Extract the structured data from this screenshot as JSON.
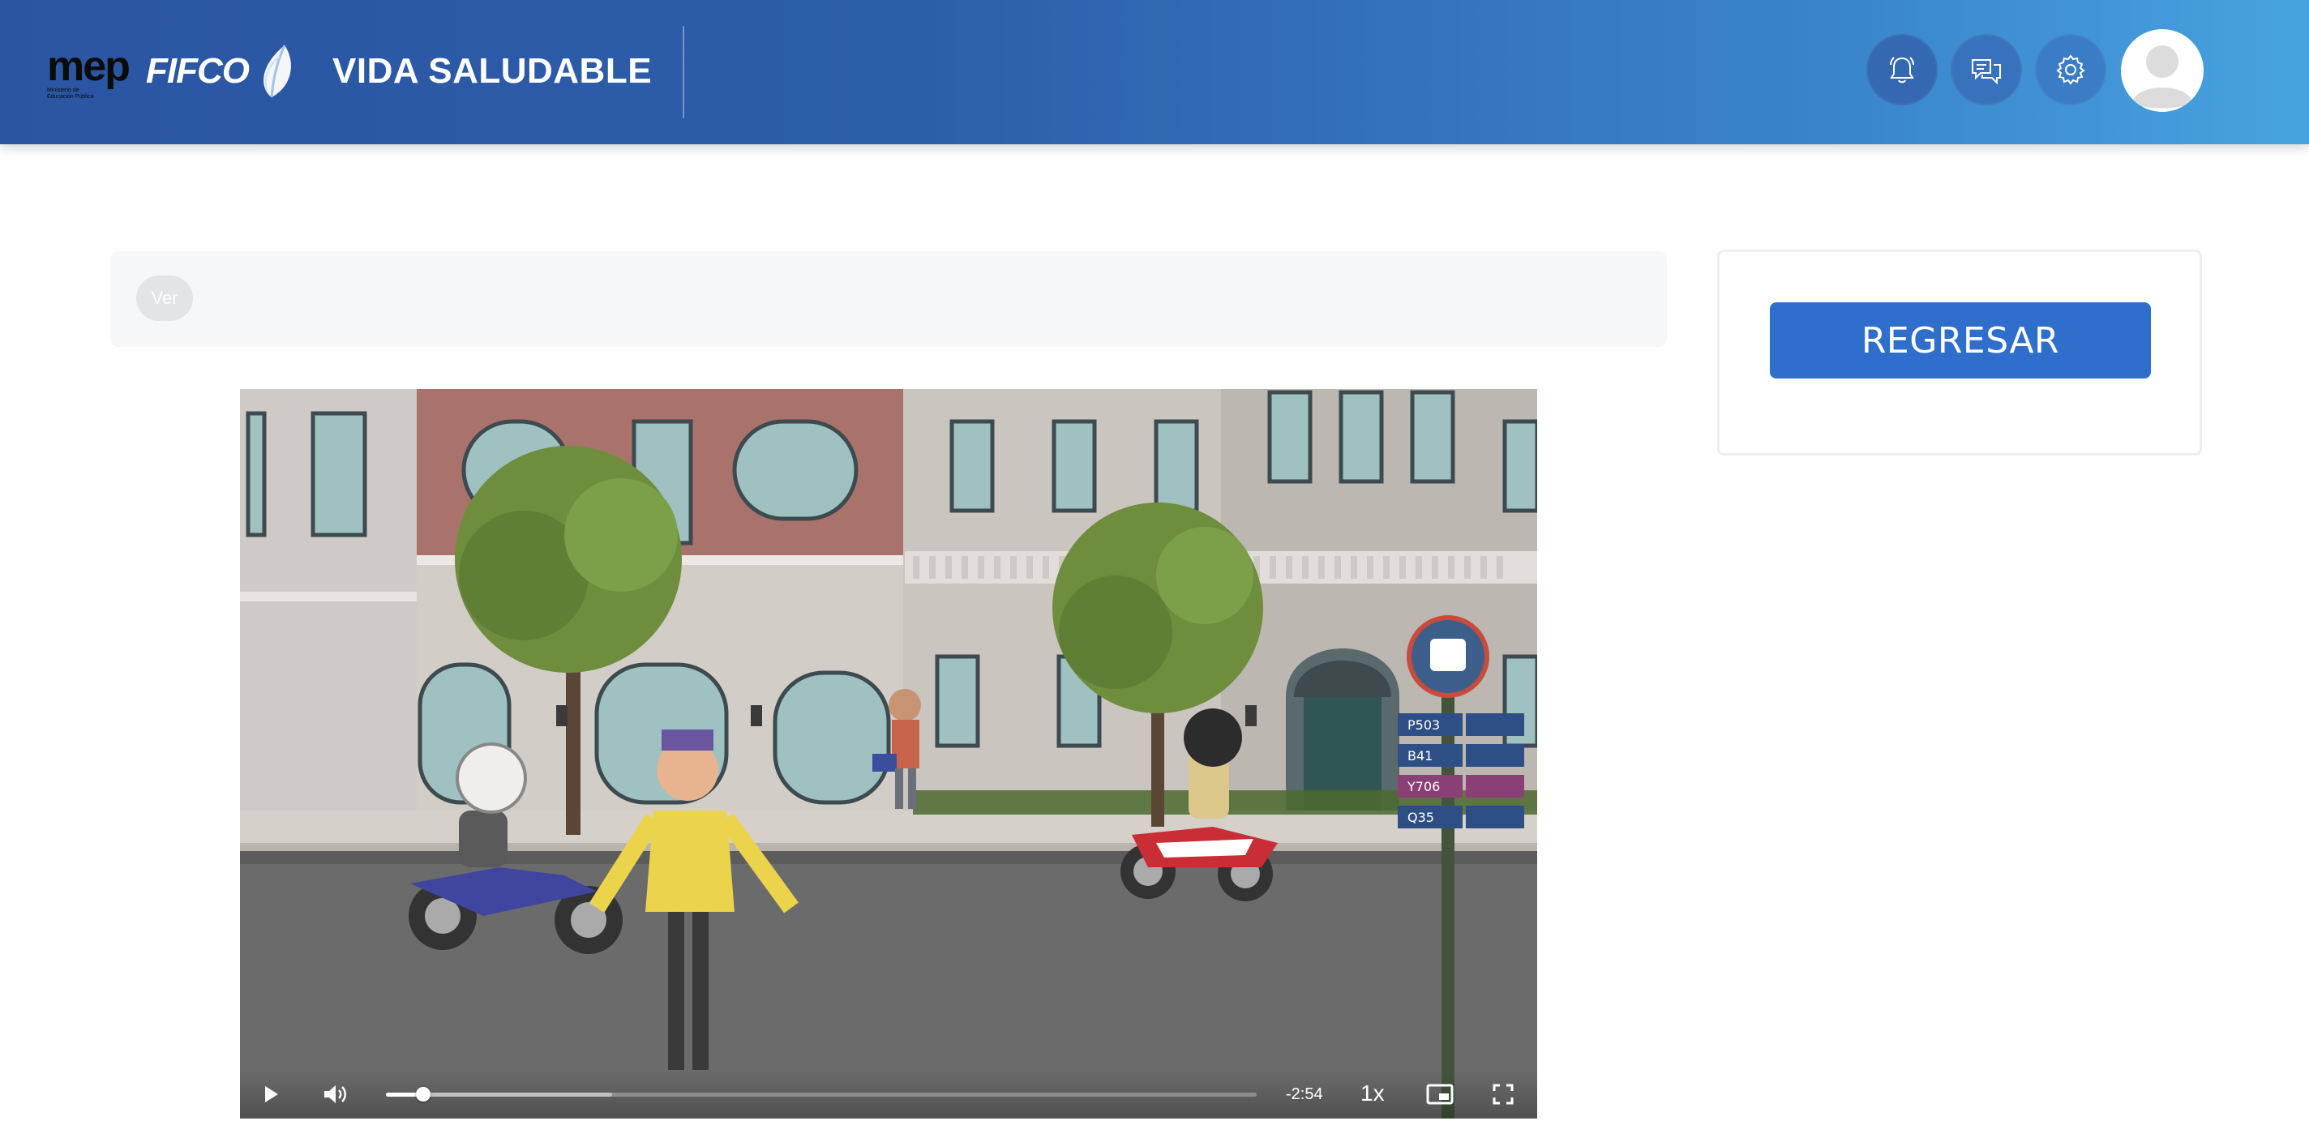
{
  "header": {
    "logo_mep": "mep",
    "logo_mep_sub": "Ministerio de Educación Pública",
    "logo_fifco": "FIFCO",
    "title": "VIDA SALUDABLE",
    "icons": [
      "bell-icon",
      "chat-icon",
      "gear-icon",
      "user-avatar-icon"
    ]
  },
  "ver_bar": {
    "label": "Ver"
  },
  "side_card": {
    "button_label": "REGRESAR"
  },
  "video": {
    "time_remaining": "-2:54",
    "playback_speed": "1x",
    "progress_fraction": 0.043,
    "buffered_fraction": 0.26,
    "bus_stop_routes": [
      "P503",
      "B41",
      "Y706",
      "Q35"
    ],
    "controls": [
      "play-icon",
      "volume-icon",
      "picture-in-picture-icon",
      "fullscreen-icon"
    ]
  },
  "colors": {
    "header_start": "#2a55a2",
    "header_end": "#47a3e0",
    "button_primary": "#2f6fcb"
  }
}
